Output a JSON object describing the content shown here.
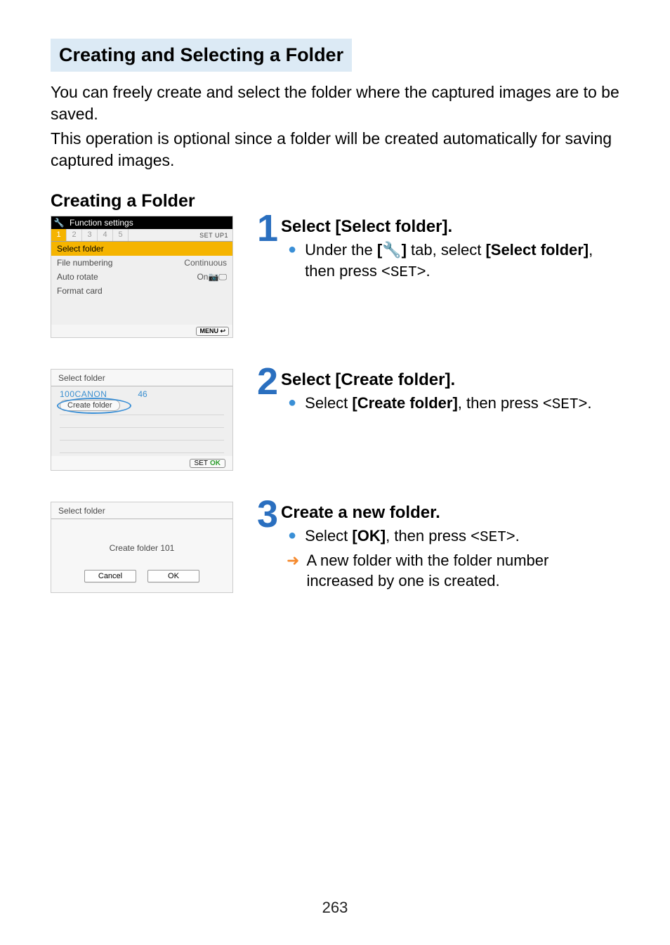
{
  "heading": "Creating and Selecting a Folder",
  "intro1": "You can freely create and select the folder where the captured images are to be saved.",
  "intro2": "This operation is optional since a folder will be created automatically for saving captured images.",
  "subHeading": "Creating a Folder",
  "steps": [
    {
      "num": "1",
      "title": "Select [Select folder].",
      "bullets": [
        {
          "type": "dot",
          "pre": "Under the ",
          "bold1": "[🔧]",
          "mid": " tab, select ",
          "bold2": "[Select folder]",
          "post": ", then press <",
          "mono": "SET",
          "tail": ">."
        }
      ]
    },
    {
      "num": "2",
      "title": "Select [Create folder].",
      "bullets": [
        {
          "type": "dot",
          "pre": "Select ",
          "bold1": "[Create folder]",
          "mid": ", then press <",
          "mono": "SET",
          "post": ">.",
          "tail": ""
        }
      ]
    },
    {
      "num": "3",
      "title": "Create a new folder.",
      "bullets": [
        {
          "type": "dot",
          "pre": "Select ",
          "bold1": "[OK]",
          "mid": ", then press <",
          "mono": "SET",
          "post": ">.",
          "tail": ""
        },
        {
          "type": "arrow",
          "text": "A new folder with the folder number increased by one is created."
        }
      ]
    }
  ],
  "shot1": {
    "topTitle": "Function settings",
    "tabs": [
      "1",
      "2",
      "3",
      "4",
      "5"
    ],
    "setup": "SET UP1",
    "items": [
      {
        "label": "Select folder",
        "val": "",
        "sel": true
      },
      {
        "label": "File numbering",
        "val": "Continuous",
        "sel": false
      },
      {
        "label": "Auto rotate",
        "val": "On📷🖵",
        "sel": false
      },
      {
        "label": "Format card",
        "val": "",
        "sel": false
      }
    ],
    "menu": "MENU ↩"
  },
  "shot2": {
    "header": "Select folder",
    "folder": "100CANON",
    "count": "46",
    "create": "Create folder",
    "setok": {
      "set": "SET",
      "ok": "OK"
    }
  },
  "shot3": {
    "header": "Select folder",
    "msg": "Create folder 101",
    "cancel": "Cancel",
    "ok": "OK"
  },
  "pageNum": "263"
}
